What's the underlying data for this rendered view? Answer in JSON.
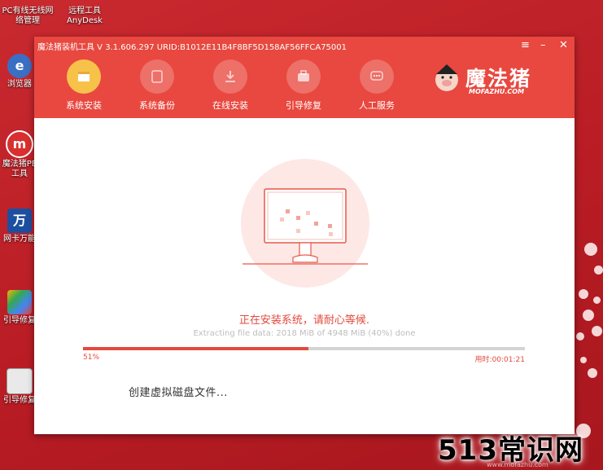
{
  "desktop": {
    "top_icons": [
      {
        "label_line1": "PC有线无线网",
        "label_line2": "络管理"
      },
      {
        "label_line1": "远程工具",
        "label_line2": "AnyDesk"
      }
    ],
    "left_icons": [
      {
        "icon": "browser-icon",
        "label": "浏览器"
      },
      {
        "icon": "mofazhu-pe-icon",
        "label_line1": "魔法猪PE",
        "label_line2": "工具"
      },
      {
        "icon": "wanka-icon",
        "glyph": "万",
        "label": "网卡万能"
      },
      {
        "icon": "boot-repair-icon",
        "label": "引导修复"
      },
      {
        "icon": "boot-repair2-icon",
        "label": "引导修复"
      }
    ],
    "watermark": "513常识网",
    "watermark_url": "www.mofazhu.com"
  },
  "window": {
    "title": "魔法猪装机工具 V 3.1.606.297 URID:B1012E11B4F8BF5D158AF56FFCA75001",
    "controls": {
      "menu": "≡",
      "minimize": "–",
      "close": "✕"
    },
    "nav": [
      {
        "label": "系统安装",
        "icon": "system-install-icon",
        "active": true
      },
      {
        "label": "系统备份",
        "icon": "system-backup-icon",
        "active": false
      },
      {
        "label": "在线安装",
        "icon": "online-install-icon",
        "active": false
      },
      {
        "label": "引导修复",
        "icon": "boot-repair-icon",
        "active": false
      },
      {
        "label": "人工服务",
        "icon": "customer-service-icon",
        "active": false
      }
    ],
    "logo": {
      "title": "魔法猪",
      "subtitle": "MOFAZHU.COM"
    },
    "status": "正在安装系统，请耐心等候.",
    "detail": "Extracting file data: 2018 MiB of 4948 MiB (40%) done",
    "progress": {
      "percent": 51,
      "label": "51%"
    },
    "elapsed": "用时:00:01:21",
    "step": "创建虚拟磁盘文件..."
  },
  "colors": {
    "primary": "#e8483f",
    "accent": "#f7c24a",
    "desktop": "#c2232b"
  }
}
